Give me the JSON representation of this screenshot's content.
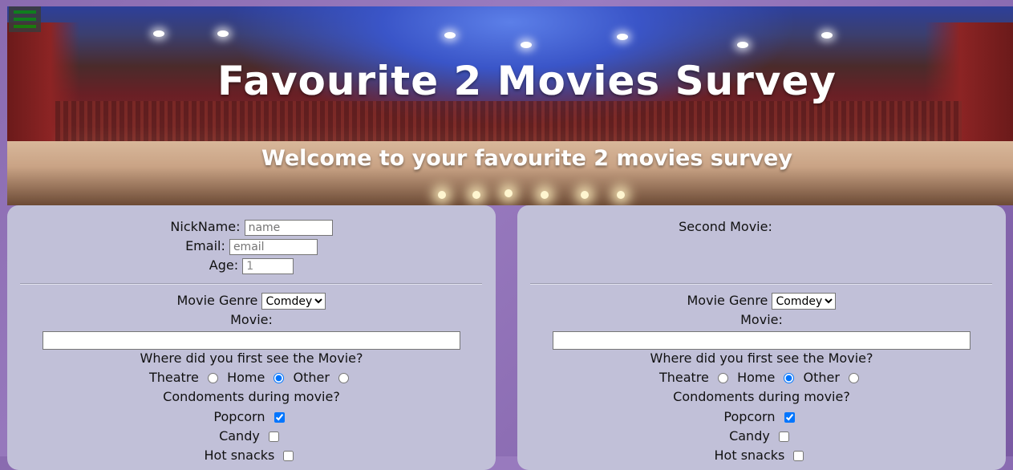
{
  "header": {
    "title": "Favourite 2 Movies Survey",
    "subtitle": "Welcome to your favourite 2 movies survey"
  },
  "menu": {
    "icon": "hamburger-menu-icon"
  },
  "left_panel": {
    "nickname_label": "NickName:",
    "nickname_placeholder": "name",
    "email_label": "Email:",
    "email_placeholder": "email",
    "age_label": "Age:",
    "age_value": "1",
    "genre_label": "Movie Genre",
    "genre_selected": "Comdey",
    "movie_label": "Movie:",
    "movie_value": "",
    "where_label": "Where did you first see the Movie?",
    "options": {
      "theatre": "Theatre",
      "home": "Home",
      "other": "Other"
    },
    "condiments_label": "Condoments during movie?",
    "popcorn_label": "Popcorn",
    "candy_label": "Candy",
    "hotsnacks_label": "Hot snacks"
  },
  "right_panel": {
    "heading": "Second Movie:",
    "genre_label": "Movie Genre",
    "genre_selected": "Comdey",
    "movie_label": "Movie:",
    "movie_value": "",
    "where_label": "Where did you first see the Movie?",
    "options": {
      "theatre": "Theatre",
      "home": "Home",
      "other": "Other"
    },
    "condiments_label": "Condoments during movie?",
    "popcorn_label": "Popcorn",
    "candy_label": "Candy",
    "hotsnacks_label": "Hot snacks"
  },
  "colors": {
    "panel_bg": "#c1c0d8",
    "page_bg": "#8a6bb0",
    "menu_bars": "#0a8a0a"
  }
}
